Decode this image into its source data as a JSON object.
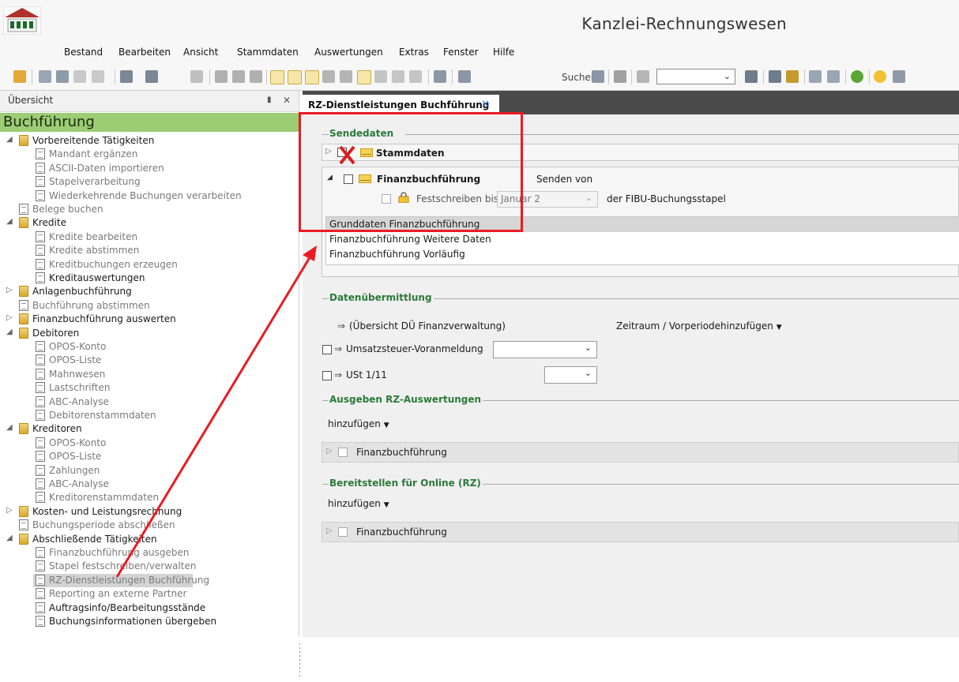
{
  "window": {
    "title": "Kanzlei-Rechnungswesen"
  },
  "menu": [
    "Bestand",
    "Bearbeiten",
    "Ansicht",
    "Stammdaten",
    "Auswertungen",
    "Extras",
    "Fenster",
    "Hilfe"
  ],
  "toolbar": {
    "search_label": "Suchen",
    "combo_value": ""
  },
  "left_panel": {
    "header": "Übersicht",
    "section_title": "Buchführung",
    "tree": [
      {
        "label": "Vorbereitende Tätigkeiten",
        "type": "folder",
        "level": 0,
        "expander": "open",
        "enabled": true
      },
      {
        "label": "Mandant ergänzen",
        "type": "doc",
        "level": 1,
        "enabled": false
      },
      {
        "label": "ASCII-Daten importieren",
        "type": "doc",
        "level": 1,
        "enabled": false
      },
      {
        "label": "Stapelverarbeitung",
        "type": "doc",
        "level": 1,
        "enabled": false
      },
      {
        "label": "Wiederkehrende Buchungen verarbeiten",
        "type": "doc",
        "level": 1,
        "enabled": false
      },
      {
        "label": "Belege buchen",
        "type": "doc",
        "level": 0,
        "enabled": false
      },
      {
        "label": "Kredite",
        "type": "folder",
        "level": 0,
        "expander": "open",
        "enabled": true
      },
      {
        "label": "Kredite bearbeiten",
        "type": "doc",
        "level": 1,
        "enabled": false
      },
      {
        "label": "Kredite abstimmen",
        "type": "doc",
        "level": 1,
        "enabled": false
      },
      {
        "label": "Kreditbuchungen erzeugen",
        "type": "doc",
        "level": 1,
        "enabled": false
      },
      {
        "label": "Kreditauswertungen",
        "type": "doc",
        "level": 1,
        "enabled": true
      },
      {
        "label": "Anlagenbuchführung",
        "type": "folder",
        "level": 0,
        "expander": "closed",
        "enabled": true
      },
      {
        "label": "Buchführung abstimmen",
        "type": "doc",
        "level": 0,
        "enabled": false
      },
      {
        "label": "Finanzbuchführung auswerten",
        "type": "folder",
        "level": 0,
        "expander": "closed",
        "enabled": true
      },
      {
        "label": "Debitoren",
        "type": "folder",
        "level": 0,
        "expander": "open",
        "enabled": true
      },
      {
        "label": "OPOS-Konto",
        "type": "doc",
        "level": 1,
        "enabled": false
      },
      {
        "label": "OPOS-Liste",
        "type": "doc",
        "level": 1,
        "enabled": false
      },
      {
        "label": "Mahnwesen",
        "type": "doc",
        "level": 1,
        "enabled": false
      },
      {
        "label": "Lastschriften",
        "type": "doc",
        "level": 1,
        "enabled": false
      },
      {
        "label": "ABC-Analyse",
        "type": "doc",
        "level": 1,
        "enabled": false
      },
      {
        "label": "Debitorenstammdaten",
        "type": "doc",
        "level": 1,
        "enabled": false
      },
      {
        "label": "Kreditoren",
        "type": "folder",
        "level": 0,
        "expander": "open",
        "enabled": true
      },
      {
        "label": "OPOS-Konto",
        "type": "doc",
        "level": 1,
        "enabled": false
      },
      {
        "label": "OPOS-Liste",
        "type": "doc",
        "level": 1,
        "enabled": false
      },
      {
        "label": "Zahlungen",
        "type": "doc",
        "level": 1,
        "enabled": false
      },
      {
        "label": "ABC-Analyse",
        "type": "doc",
        "level": 1,
        "enabled": false
      },
      {
        "label": "Kreditorenstammdaten",
        "type": "doc",
        "level": 1,
        "enabled": false
      },
      {
        "label": "Kosten- und Leistungsrechnung",
        "type": "folder",
        "level": 0,
        "expander": "closed",
        "enabled": true
      },
      {
        "label": "Buchungsperiode abschließen",
        "type": "doc",
        "level": 0,
        "enabled": false
      },
      {
        "label": "Abschließende Tätigkeiten",
        "type": "folder",
        "level": 0,
        "expander": "open",
        "enabled": true
      },
      {
        "label": "Finanzbuchführung ausgeben",
        "type": "doc",
        "level": 1,
        "enabled": false
      },
      {
        "label": "Stapel festschreiben/verwalten",
        "type": "doc",
        "level": 1,
        "enabled": false
      },
      {
        "label": "RZ-Dienstleistungen Buchführung",
        "type": "doc",
        "level": 1,
        "enabled": false,
        "selected": true
      },
      {
        "label": "Reporting an externe Partner",
        "type": "doc",
        "level": 1,
        "enabled": false
      },
      {
        "label": "Auftragsinfo/Bearbeitungsstände",
        "type": "doc",
        "level": 1,
        "enabled": true
      },
      {
        "label": "Buchungsinformationen übergeben",
        "type": "doc",
        "level": 1,
        "enabled": true
      }
    ]
  },
  "tab": {
    "label": "RZ-Dienstleistungen Buchführung"
  },
  "sendedaten": {
    "title": "Sendedaten",
    "stammdaten_label": "Stammdaten",
    "fibu_label": "Finanzbuchführung",
    "senden_von": "Senden von",
    "festschreiben_label": "Festschreiben bis",
    "festschreiben_value": "Januar 2",
    "fibu_stapel_label": "der FIBU-Buchungsstapel",
    "list": [
      "Grunddaten Finanzbuchführung",
      "Finanzbuchführung Weitere Daten",
      "Finanzbuchführung Vorläufig"
    ]
  },
  "datenuebermittlung": {
    "title": "Datenübermittlung",
    "uebersicht_label": "(Übersicht DÜ Finanzverwaltung)",
    "zeitraum_label": "Zeitraum / Vorperiode",
    "hinzufuegen": "hinzufügen",
    "ustva_label": "Umsatzsteuer-Voranmeldung",
    "ust_label": "USt 1/11"
  },
  "ausgeben": {
    "title": "Ausgeben RZ-Auswertungen",
    "hinzufuegen": "hinzufügen",
    "item": "Finanzbuchführung"
  },
  "bereitstellen": {
    "title": "Bereitstellen für Online (RZ)",
    "hinzufuegen": "hinzufügen",
    "item": "Finanzbuchführung"
  },
  "colors": {
    "accent_green": "#9ccc74",
    "annotation_red": "#ea1b24",
    "group_title_green": "#2b7a3a",
    "tab_strip": "#4b4b4b"
  }
}
